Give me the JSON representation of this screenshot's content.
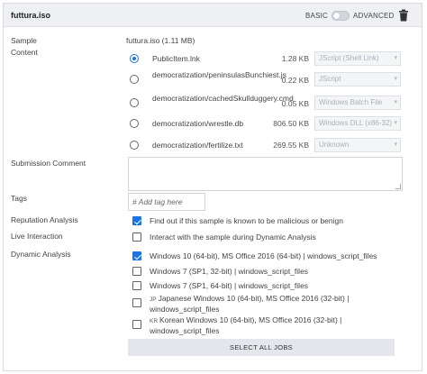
{
  "header": {
    "title": "futtura.iso",
    "mode_basic": "BASIC",
    "mode_advanced": "ADVANCED",
    "toggle_state": "basic"
  },
  "labels": {
    "sample": "Sample",
    "content": "Content",
    "submission_comment": "Submission Comment",
    "tags": "Tags",
    "reputation_analysis": "Reputation Analysis",
    "live_interaction": "Live Interaction",
    "dynamic_analysis": "Dynamic Analysis"
  },
  "sample": {
    "title": "futtura.iso (1.11 MB)",
    "files": [
      {
        "name": "PublicItem.lnk",
        "size": "1.28 KB",
        "type": "JScript (Shell Link)",
        "selected": true
      },
      {
        "name": "democratization/peninsulasBunchiest.js",
        "size": "0.22 KB",
        "type": "JScript",
        "selected": false
      },
      {
        "name": "democratization/cachedSkullduggery.cmd",
        "size": "0.05 KB",
        "type": "Windows Batch File",
        "selected": false
      },
      {
        "name": "democratization/wrestle.db",
        "size": "806.50 KB",
        "type": "Windows DLL (x86-32)",
        "selected": false
      },
      {
        "name": "democratization/fertilize.txt",
        "size": "269.55 KB",
        "type": "Unknown",
        "selected": false
      }
    ]
  },
  "comment": {
    "value": ""
  },
  "tags": {
    "placeholder": "# Add tag here"
  },
  "reputation": {
    "label": "Find out if this sample is known to be malicious or benign",
    "checked": true
  },
  "live": {
    "label": "Interact with the sample during Dynamic Analysis",
    "checked": false
  },
  "dynamic": {
    "jobs": [
      {
        "flag": "",
        "label": "Windows 10 (64-bit), MS Office 2016 (64-bit) | windows_script_files",
        "checked": true
      },
      {
        "flag": "",
        "label": "Windows 7 (SP1, 32-bit) | windows_script_files",
        "checked": false
      },
      {
        "flag": "",
        "label": "Windows 7 (SP1, 64-bit) | windows_script_files",
        "checked": false
      },
      {
        "flag": "JP",
        "label": "Japanese Windows 10 (64-bit), MS Office 2016 (32-bit) | windows_script_files",
        "checked": false
      },
      {
        "flag": "KR",
        "label": "Korean Windows 10 (64-bit), MS Office 2016 (32-bit) | windows_script_files",
        "checked": false
      }
    ]
  },
  "select_all_label": "SELECT ALL JOBS",
  "colors": {
    "accent": "#1a73e8",
    "header_bg": "#eef0f3",
    "button_bg": "#e3e6ea"
  },
  "icons": {
    "delete": "trash-icon",
    "type_select": "chevron-down-icon"
  }
}
